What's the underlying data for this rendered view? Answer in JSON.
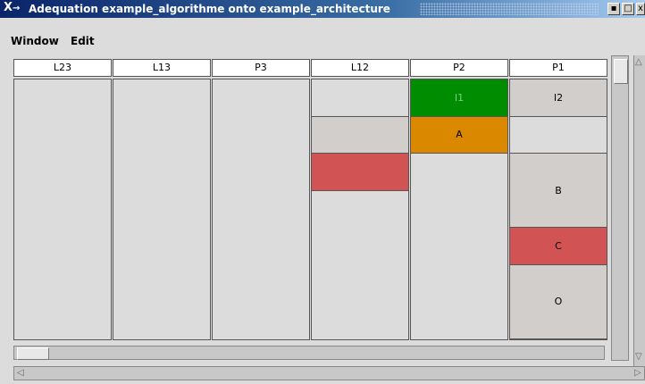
{
  "window": {
    "title": "Adequation example_algorithme onto example_architecture",
    "logo": "X",
    "logo_arrow": "→",
    "buttons": [
      {
        "icon": "minimize-icon",
        "glyph": "▪"
      },
      {
        "icon": "maximize-icon",
        "glyph": "□"
      },
      {
        "icon": "close-icon",
        "glyph": "x"
      }
    ]
  },
  "menubar": {
    "window_label": "Window",
    "edit_label": "Edit"
  },
  "columns": [
    {
      "name": "L23",
      "blocks": []
    },
    {
      "name": "L13",
      "blocks": []
    },
    {
      "name": "P3",
      "blocks": []
    },
    {
      "name": "L12",
      "blocks": [
        {
          "label": "",
          "color": "#dcdcdc",
          "start": 0,
          "end": 1
        },
        {
          "label": "",
          "color": "#d2cecb",
          "start": 1,
          "end": 2
        },
        {
          "label": "",
          "color": "#d15353",
          "start": 2,
          "end": 3
        }
      ]
    },
    {
      "name": "P2",
      "blocks": [
        {
          "label": "I1",
          "color": "#008c00",
          "text_color": "#7fd07f",
          "start": 0,
          "end": 1
        },
        {
          "label": "A",
          "color": "#d98800",
          "start": 1,
          "end": 2
        }
      ]
    },
    {
      "name": "P1",
      "blocks": [
        {
          "label": "I2",
          "color": "#d2cecb",
          "start": 0,
          "end": 1
        },
        {
          "label": "",
          "color": "#dcdcdc",
          "start": 1,
          "end": 2
        },
        {
          "label": "B",
          "color": "#d2cecb",
          "start": 2,
          "end": 4
        },
        {
          "label": "C",
          "color": "#d15353",
          "start": 4,
          "end": 5
        },
        {
          "label": "O",
          "color": "#d2cecb",
          "start": 5,
          "end": 7
        }
      ]
    }
  ]
}
